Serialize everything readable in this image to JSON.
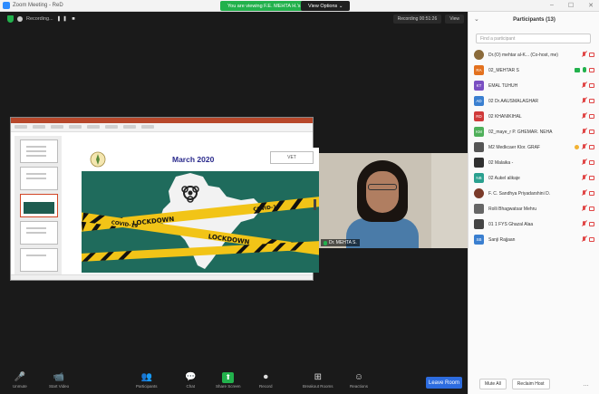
{
  "window": {
    "title": "Zoom Meeting - ReD",
    "banner": "You are viewing F.E. MEHTA H.'s screen",
    "view_options": "View Options ⌄",
    "controls": [
      "–",
      "☐",
      "✕"
    ]
  },
  "meeting": {
    "recording_label": "Recording...",
    "recording_controls": "❚❚ ■",
    "recording_time": "Recording 00:51:26",
    "view_label": "View"
  },
  "slide": {
    "title": "March 2020",
    "logo_text": "VET",
    "tape_text": "LOCKDOWN",
    "tape_text_2": "COVID-19"
  },
  "video": {
    "participant_name": "Dr. MEHTA S."
  },
  "toolbar": {
    "buttons": [
      {
        "label": "Unmute",
        "icon": "🎤"
      },
      {
        "label": "Start Video",
        "icon": "📹"
      },
      {
        "label": "Participants",
        "icon": "👥"
      },
      {
        "label": "Chat",
        "icon": "💬"
      },
      {
        "label": "Share Screen",
        "icon": "⬆"
      },
      {
        "label": "Record",
        "icon": "⏺"
      },
      {
        "label": "Breakout Rooms",
        "icon": "⊞"
      },
      {
        "label": "Reactions",
        "icon": "☺"
      }
    ],
    "leave": "Leave Room"
  },
  "participants_panel": {
    "title": "Participants (13)",
    "collapse_icon": "chevron-down",
    "search_placeholder": "Find a participant",
    "footer": {
      "mute_all": "Mute All",
      "reclaim_host": "Reclaim Host",
      "more": "…"
    },
    "participants": [
      {
        "initials": "",
        "name": "Dr.(O) mehtar al-K... (Co-host, me)",
        "color": "#8a6a3a",
        "avatar": "photo",
        "icons": [
          "mic-off",
          "cam-off"
        ]
      },
      {
        "initials": "RA",
        "name": "02_MEHTAR S",
        "color": "#e3711e",
        "icons": [
          "share",
          "mic-on",
          "cam-off"
        ]
      },
      {
        "initials": "KT",
        "name": "EMAL TUHUH",
        "color": "#7a4fc2",
        "icons": [
          "mic-off",
          "cam-off"
        ]
      },
      {
        "initials": "AD",
        "name": "02 Dr.AAUSMALAGHAR",
        "color": "#3a7fd0",
        "icons": [
          "mic-off",
          "cam-off"
        ]
      },
      {
        "initials": "RD",
        "name": "02 KHANIKIHAL",
        "color": "#d03a3a",
        "icons": [
          "mic-off",
          "cam-off"
        ]
      },
      {
        "initials": "KM",
        "name": "02_maye_r P. GHEMAR. NEHA",
        "color": "#4fb05a",
        "icons": [
          "mic-off",
          "cam-off"
        ]
      },
      {
        "initials": "",
        "name": "M2 Medkcaer Klor. GRAF",
        "color": "#555555",
        "avatar": "photo2",
        "icons": [
          "hand",
          "mic-off",
          "cam-off"
        ]
      },
      {
        "initials": "",
        "name": "02 Malaika -",
        "color": "#2f2f2f",
        "avatar": "photo2",
        "icons": [
          "mic-off",
          "cam-off"
        ]
      },
      {
        "initials": "NB",
        "name": "02 Aukel alikaje",
        "color": "#2aa08f",
        "icons": [
          "mic-off",
          "cam-off"
        ]
      },
      {
        "initials": "",
        "name": "F. C. Sandhya Priyadarshini D.",
        "color": "#7a3a2a",
        "avatar": "photo",
        "icons": [
          "mic-off",
          "cam-off"
        ]
      },
      {
        "initials": "",
        "name": "Rolli Bhagwatsar Mehru",
        "color": "#666666",
        "avatar": "photo2",
        "icons": [
          "mic-off",
          "cam-off"
        ]
      },
      {
        "initials": "",
        "name": "01 1 FYS Ghazal Alaa",
        "color": "#444444",
        "avatar": "photo2",
        "icons": [
          "mic-off",
          "cam-off"
        ]
      },
      {
        "initials": "SB",
        "name": "Sanji Rajjaan",
        "color": "#3a7fd0",
        "icons": [
          "mic-off",
          "cam-off"
        ]
      }
    ]
  }
}
